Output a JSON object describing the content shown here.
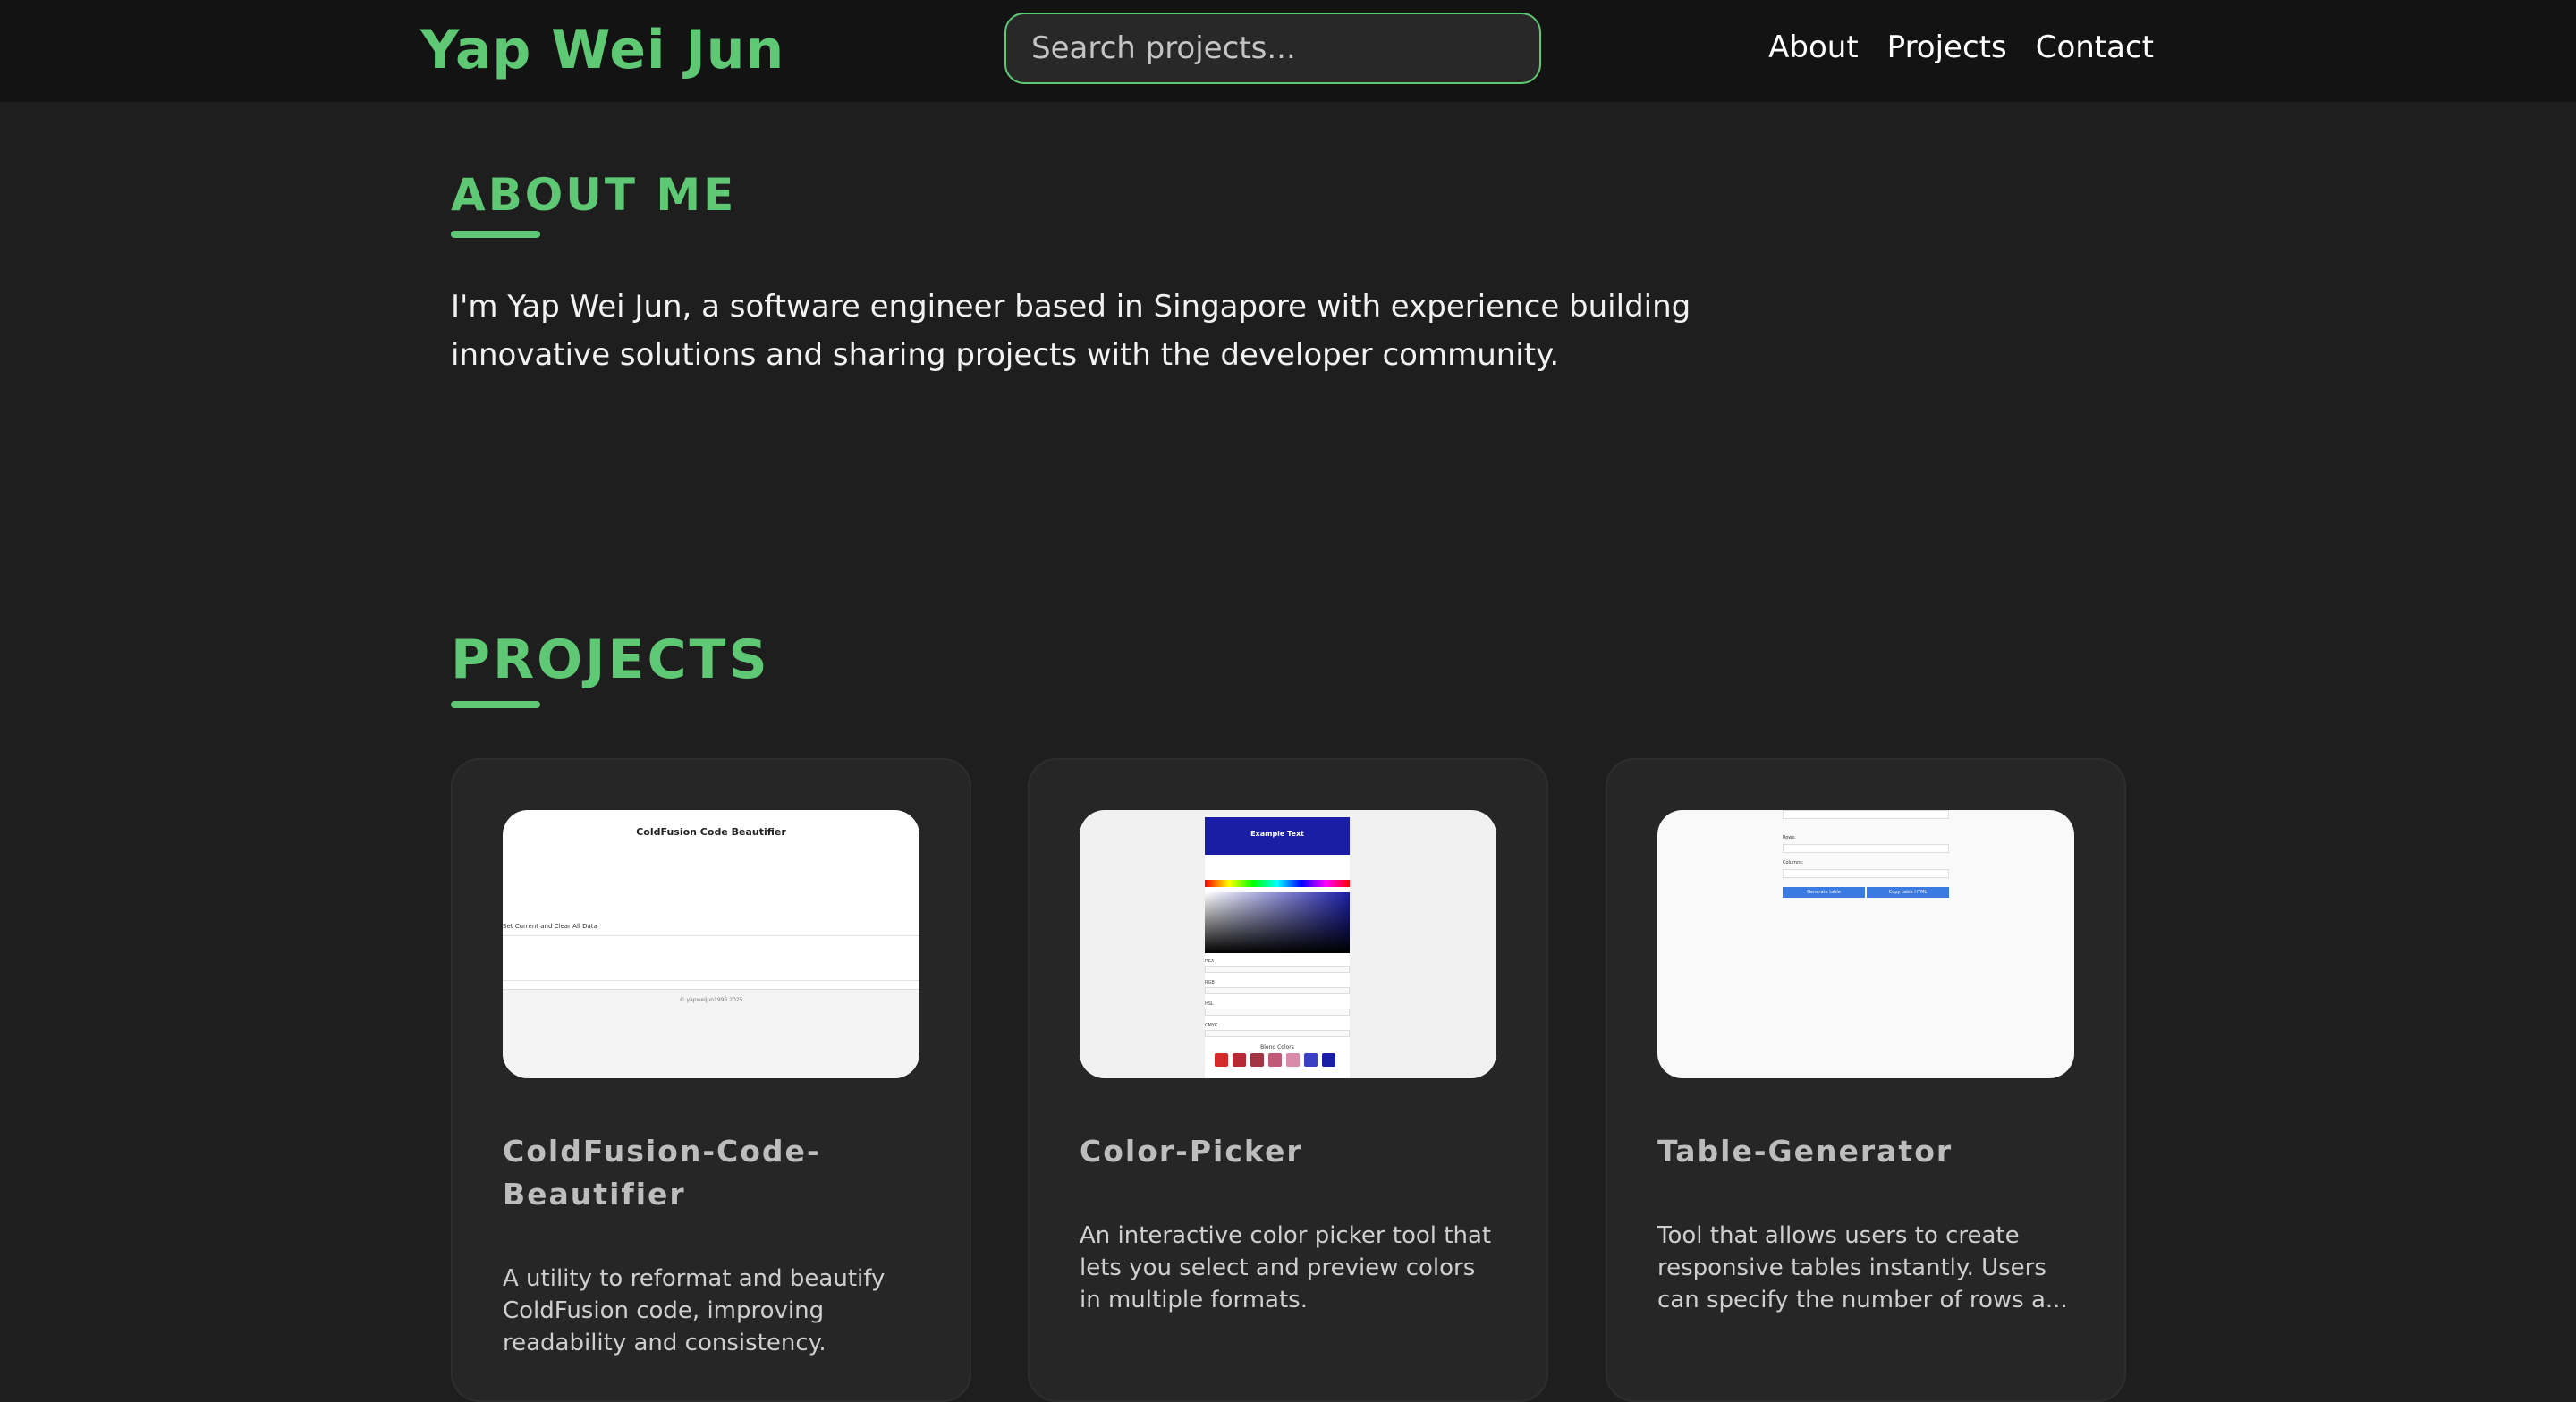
{
  "header": {
    "brand": "Yap Wei Jun",
    "search_placeholder": "Search projects...",
    "nav": [
      "About",
      "Projects",
      "Contact"
    ]
  },
  "about": {
    "title": "ABOUT ME",
    "text": "I'm Yap Wei Jun, a software engineer based in Singapore with experience building innovative solutions and sharing projects with the developer community."
  },
  "projects": {
    "title": "PROJECTS",
    "items": [
      {
        "title": "ColdFusion-Code-Beautifier",
        "description": "A utility to reformat and beautify ColdFusion code, improving readability and consistency.",
        "thumb": {
          "heading": "ColdFusion Code Beautifier",
          "small_text": "Set Current and Clear All Data",
          "footer": "© yapweijun1996 2025"
        }
      },
      {
        "title": "Color-Picker",
        "description": "An interactive color picker tool that lets you select and preview colors in multiple formats.",
        "thumb": {
          "banner": "Example Text",
          "labels": [
            "HEX",
            "RGB",
            "HSL",
            "CMYK"
          ],
          "blend": "Blend Colors",
          "swatches": [
            "#d42a2a",
            "#b72a35",
            "#a23545",
            "#c05a78",
            "#d88aa8",
            "#3a3fc4",
            "#1a1ea6"
          ],
          "banner_color": "#1a1ea6"
        }
      },
      {
        "title": "Table-Generator",
        "description": "Tool that allows users to create responsive tables instantly. Users can specify the number of rows a...",
        "thumb": {
          "labels": [
            "Rows:",
            "Columns:"
          ],
          "buttons": [
            "Generate table",
            "Copy table HTML"
          ]
        }
      }
    ]
  },
  "colors": {
    "accent": "#5ec874",
    "background": "#1e1e1e",
    "header": "#131313",
    "card": "#262626"
  }
}
